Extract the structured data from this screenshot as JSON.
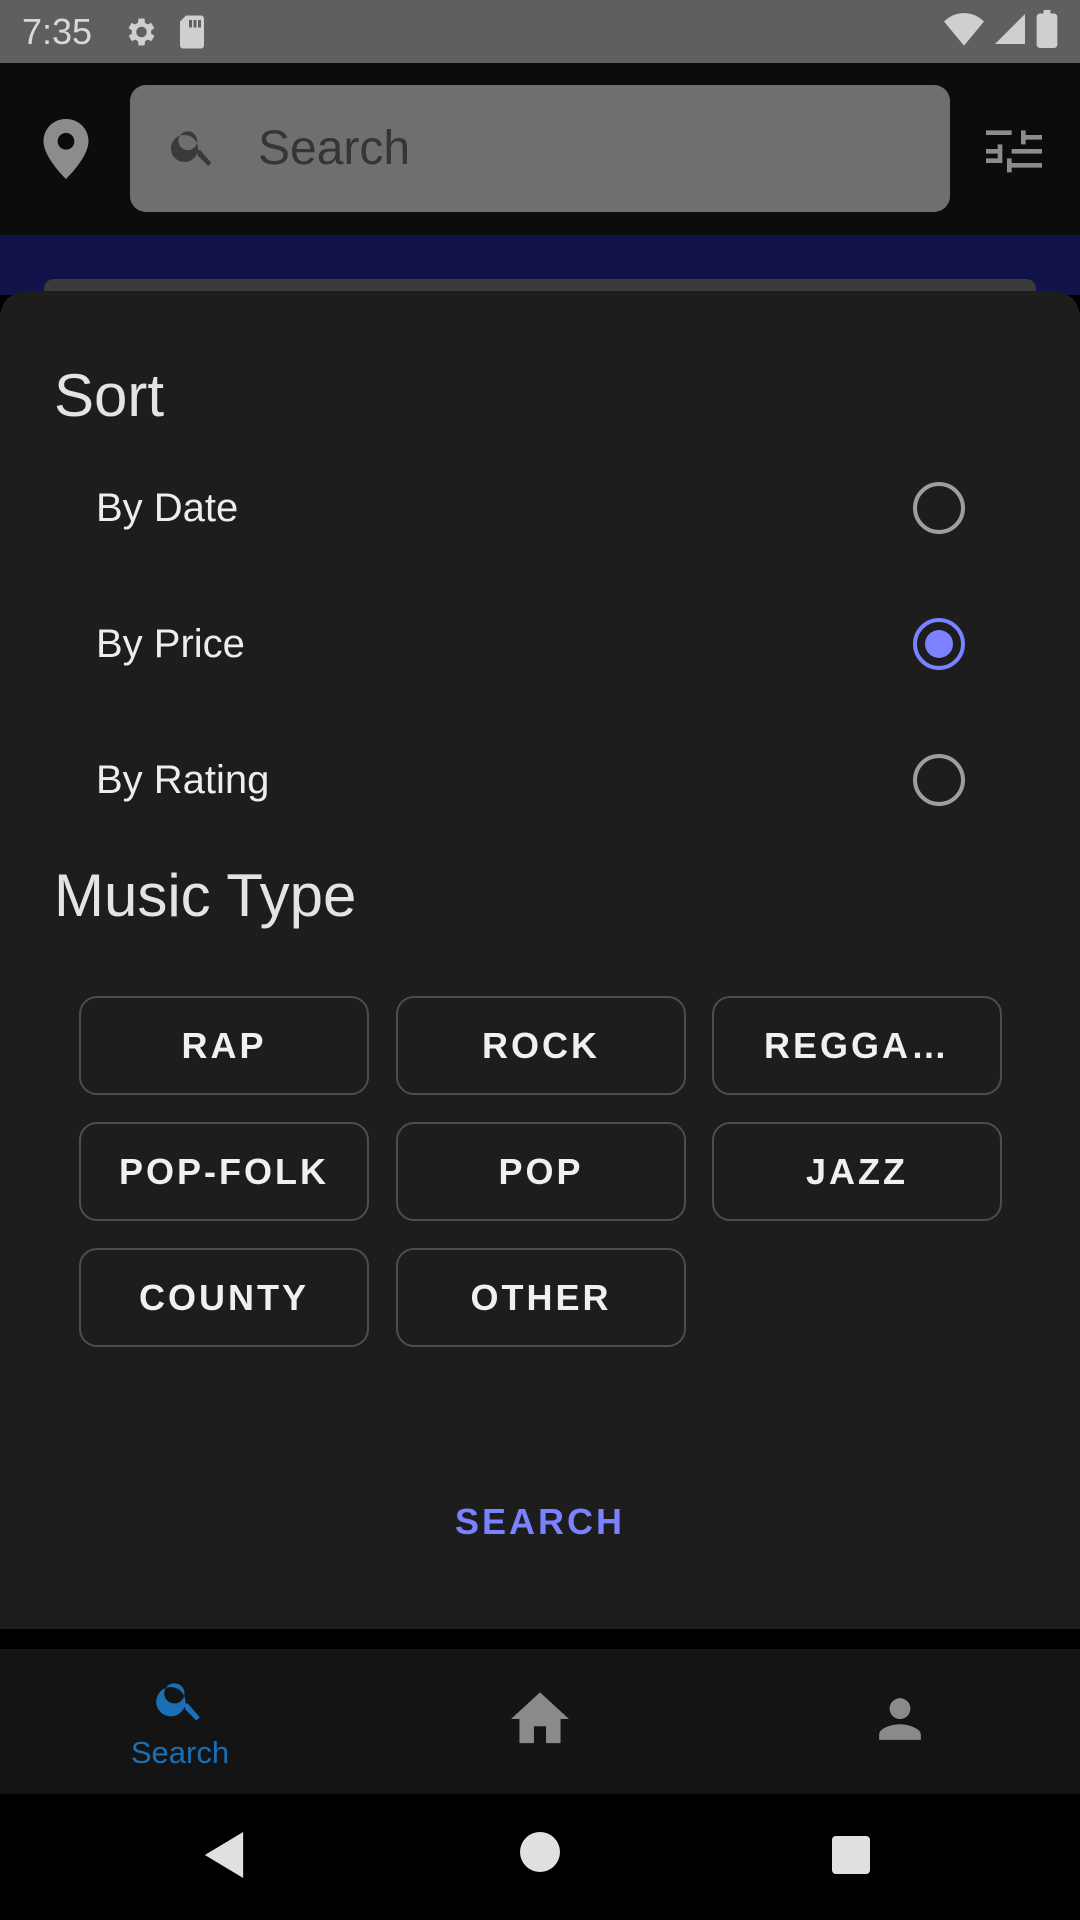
{
  "status_bar": {
    "time": "7:35",
    "icons": [
      "gear-icon",
      "sd-card-icon",
      "wifi-icon",
      "signal-icon",
      "battery-icon"
    ]
  },
  "app_bar": {
    "location_icon": "location-pin-icon",
    "search_placeholder": "Search",
    "search_icon": "search-icon",
    "filter_icon": "tune-icon"
  },
  "filter_sheet": {
    "sort_title": "Sort",
    "sort_options": [
      {
        "label": "By Date",
        "selected": false
      },
      {
        "label": "By Price",
        "selected": true
      },
      {
        "label": "By Rating",
        "selected": false
      }
    ],
    "music_type_title": "Music Type",
    "music_types": [
      "RAP",
      "ROCK",
      "REGGA…",
      "POP-FOLK",
      "POP",
      "JAZZ",
      "COUNTY",
      "OTHER"
    ],
    "search_button": "SEARCH"
  },
  "bottom_nav": {
    "items": [
      {
        "label": "Search",
        "icon": "search-icon",
        "active": true
      },
      {
        "label": "",
        "icon": "home-icon",
        "active": false
      },
      {
        "label": "",
        "icon": "person-icon",
        "active": false
      }
    ]
  },
  "colors": {
    "accent": "#7a82ff",
    "nav_active": "#1a6fb5",
    "sheet_background": "#1d1d1d"
  }
}
